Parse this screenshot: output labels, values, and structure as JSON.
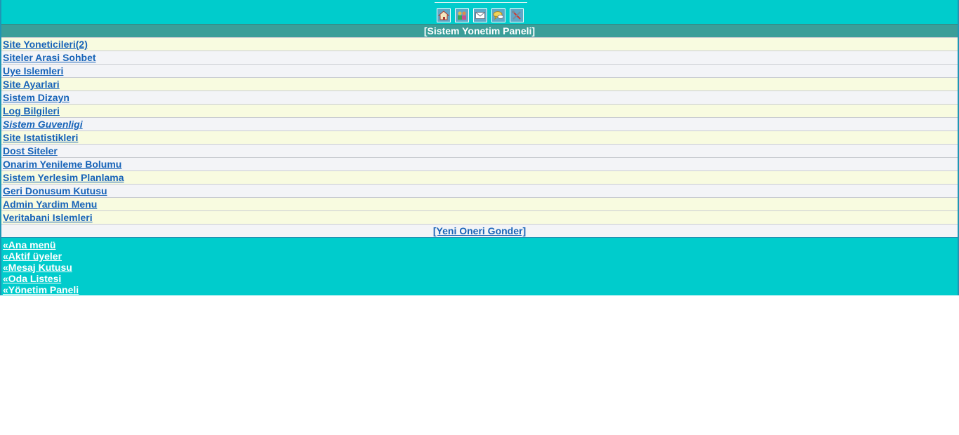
{
  "toolbar": {
    "icons": [
      {
        "name": "home-icon"
      },
      {
        "name": "users-icon"
      },
      {
        "name": "mail-icon"
      },
      {
        "name": "chat-icon"
      },
      {
        "name": "tools-icon"
      }
    ]
  },
  "panel": {
    "title": "[Sistem Yonetim Paneli]"
  },
  "menu": {
    "items": [
      {
        "label": "Site Yoneticileri(2)"
      },
      {
        "label": "Siteler Arasi Sohbet"
      },
      {
        "label": "Uye Islemleri"
      },
      {
        "label": "Site Ayarlari"
      },
      {
        "label": "Sistem Dizayn"
      },
      {
        "label": "Log Bilgileri"
      },
      {
        "label": "Sistem Guvenligi"
      },
      {
        "label": "Site Istatistikleri"
      },
      {
        "label": "Dost Siteler"
      },
      {
        "label": "Onarim Yenileme Bolumu"
      },
      {
        "label": "Sistem Yerlesim Planlama"
      },
      {
        "label": "Geri Donusum Kutusu"
      },
      {
        "label": "Admin Yardim Menu"
      },
      {
        "label": "Veritabani Islemleri"
      }
    ],
    "suggest_label": "[Yeni Oneri Gonder]"
  },
  "bottom_nav": {
    "links": [
      {
        "label": "«Ana menü"
      },
      {
        "label": "«Aktif üyeler"
      },
      {
        "label": "«Mesaj Kutusu"
      },
      {
        "label": "«Oda Listesi"
      },
      {
        "label": "«Yönetim Paneli"
      }
    ]
  },
  "colors": {
    "accent": "#00cccc",
    "title_bar": "#3b9e99",
    "link": "#1763b8"
  }
}
